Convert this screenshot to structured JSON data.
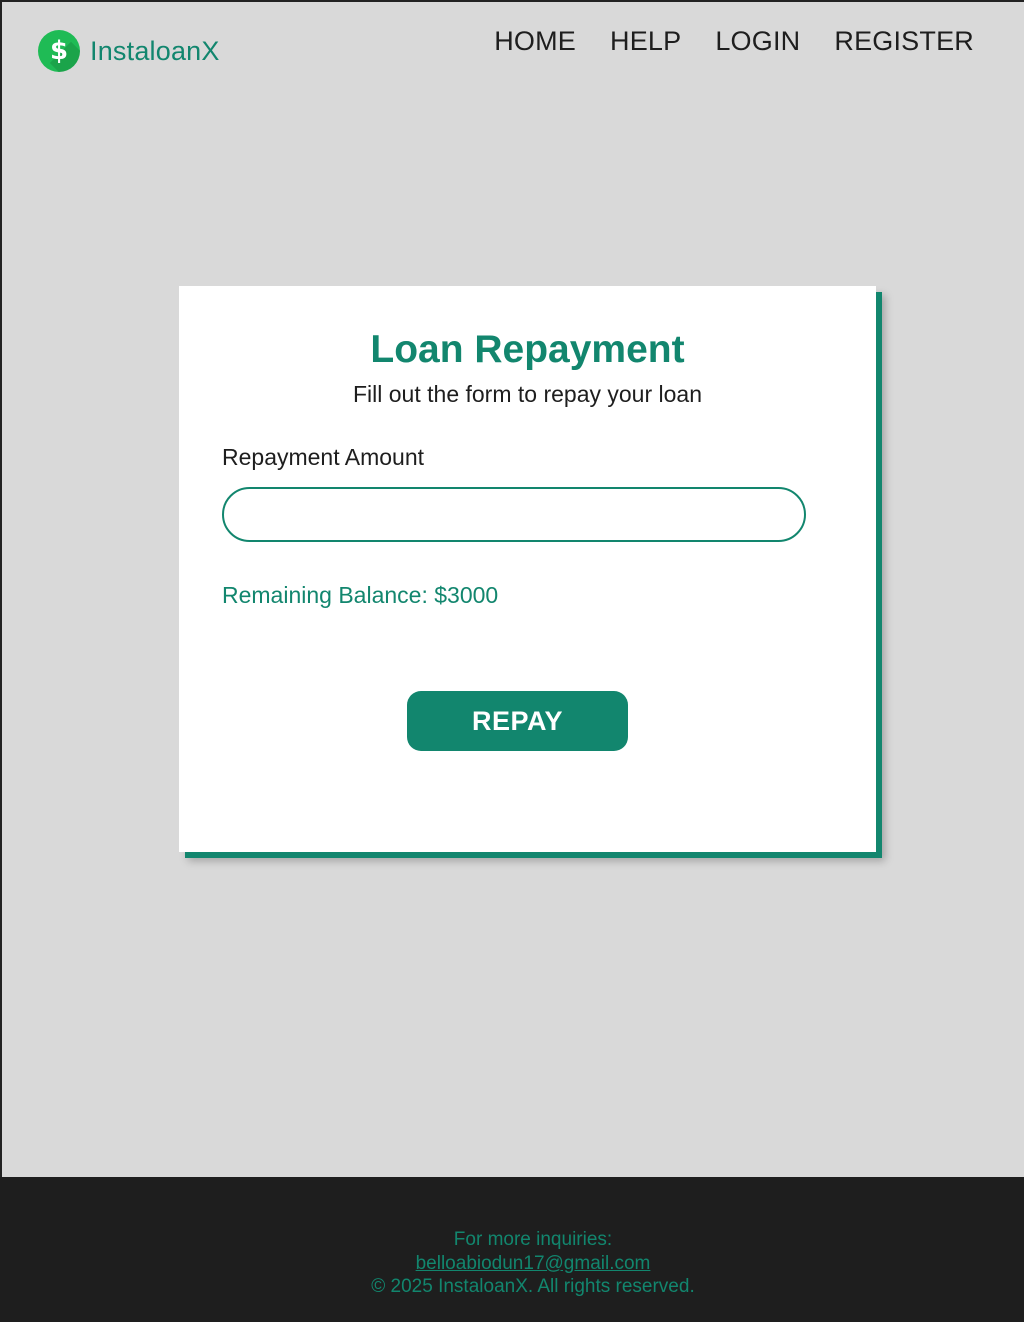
{
  "header": {
    "logo_icon_glyph": "$",
    "logo_icon": "dollar-circle-icon",
    "brand": "InstaloanX",
    "nav": [
      "HOME",
      "HELP",
      "LOGIN",
      "REGISTER"
    ]
  },
  "form": {
    "title": "Loan Repayment",
    "subtitle": "Fill out the form to repay your loan",
    "amount_label": "Repayment Amount",
    "amount_value": "",
    "amount_placeholder": "",
    "balance_text": "Remaining Balance: $3000",
    "submit_label": "REPAY"
  },
  "footer": {
    "inquiries": "For more inquiries:",
    "email": "belloabiodun17@gmail.com",
    "copyright": "© 2025 InstaloanX. All rights reserved."
  },
  "colors": {
    "accent": "#12866e",
    "logo_green": "#1fbb55",
    "background": "#d9d9d9",
    "footer_bg": "#1e1e1e"
  }
}
